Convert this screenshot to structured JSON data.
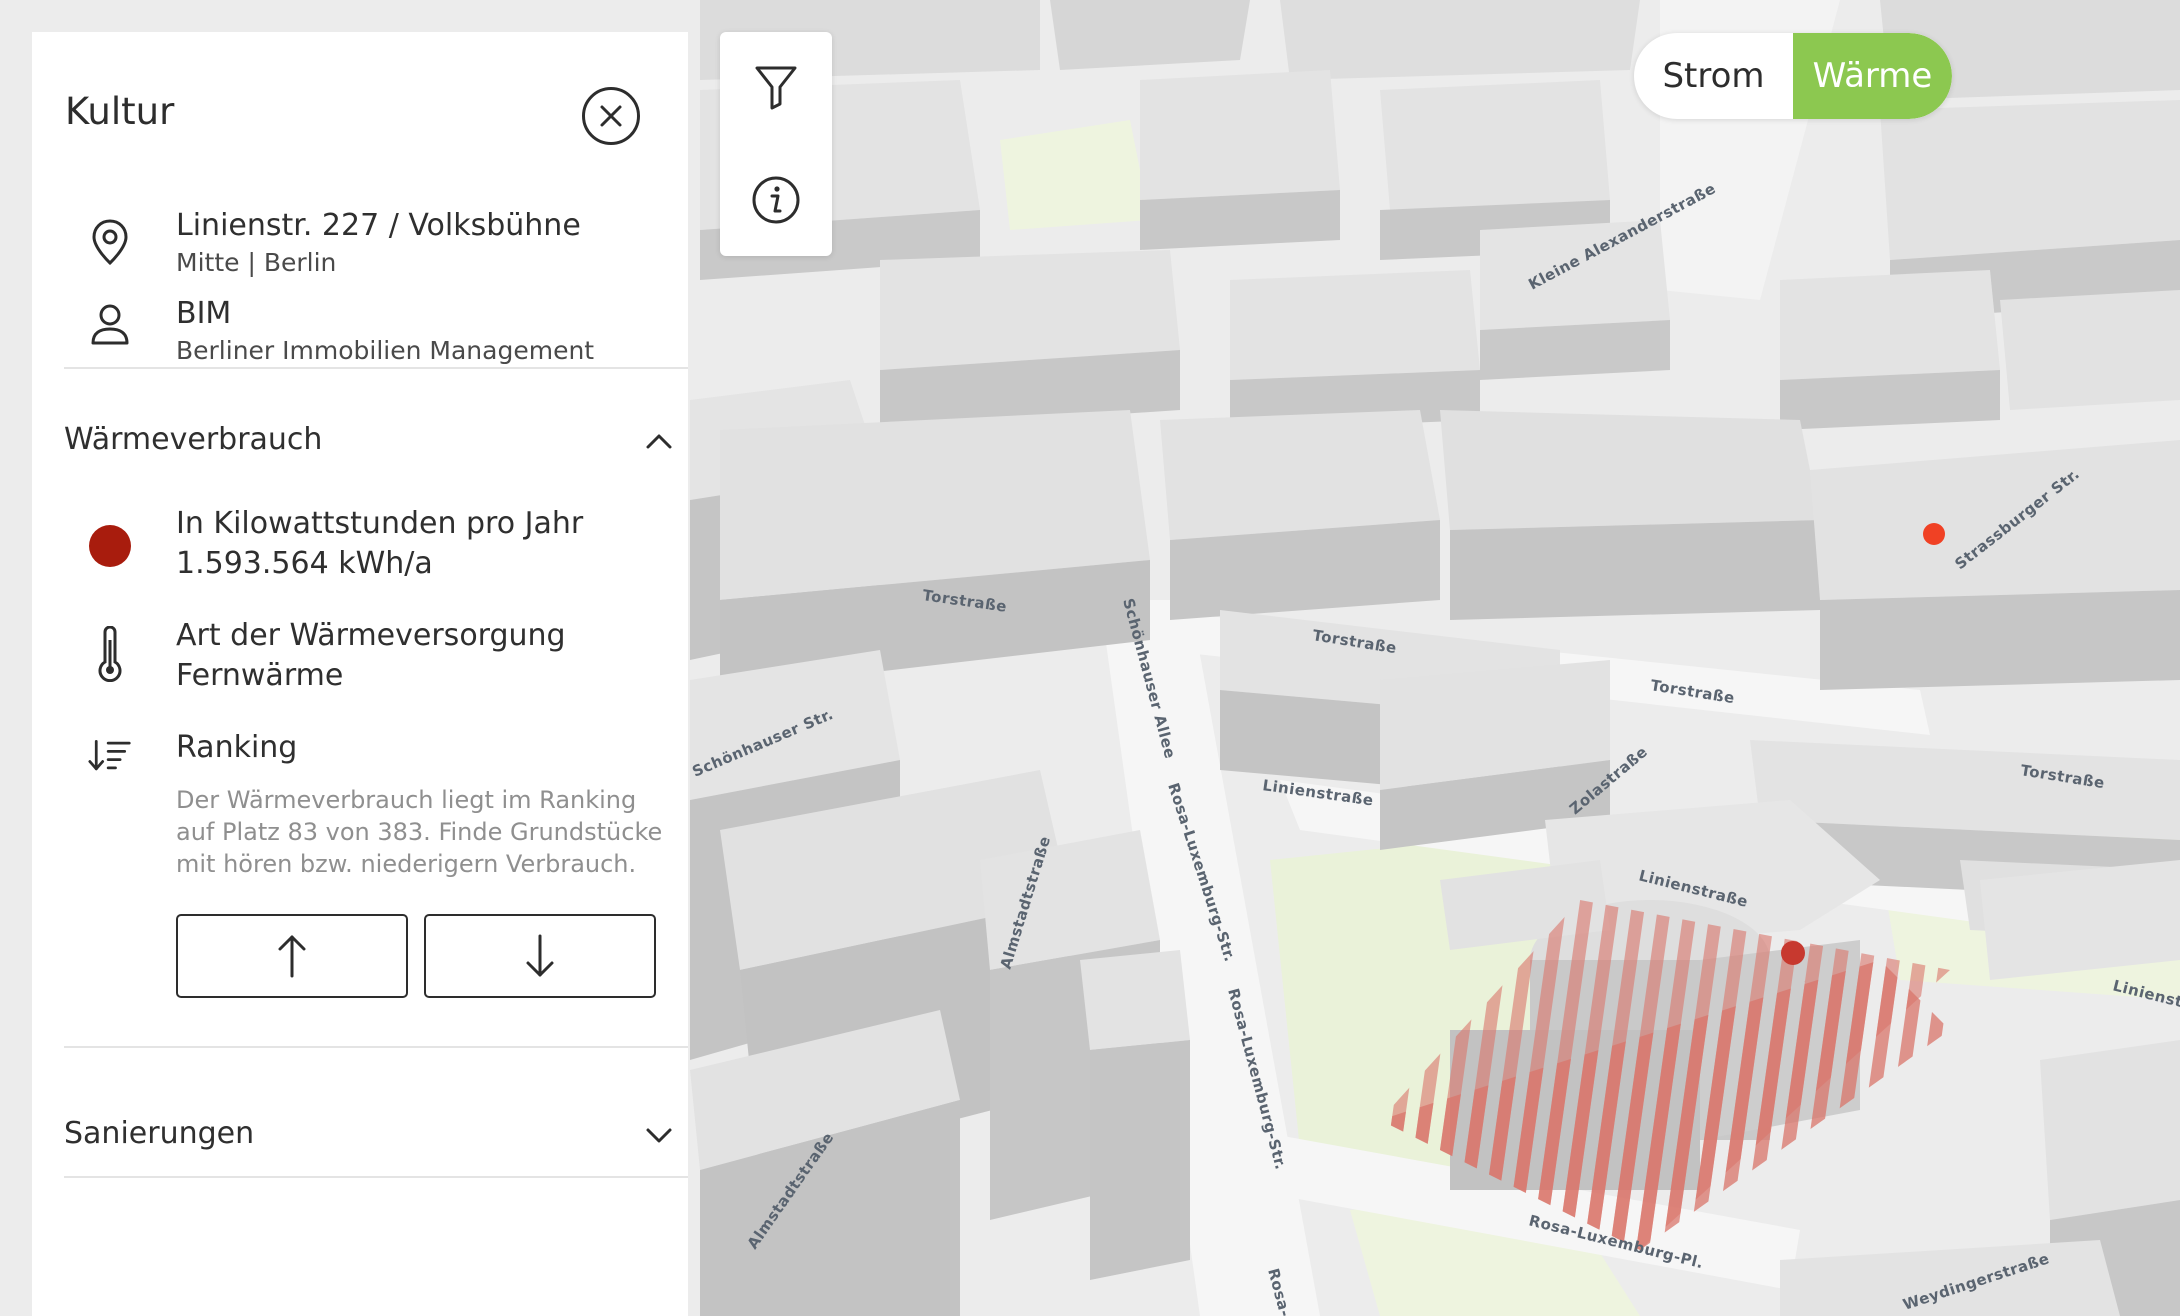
{
  "map": {
    "street_labels": [
      "Torstraße",
      "Torstraße",
      "Torstraße",
      "Torstraße",
      "Linienstraße",
      "Linienstraße",
      "Linienstraße",
      "Rosa-Luxemburg-Str.",
      "Rosa-Luxemburg-Str.",
      "Rosa-Luxemburg-Pl.",
      "Rosa-Lu",
      "Almstadtstraße",
      "Almstadtstraße",
      "Weydingerstraße",
      "Zolastraße",
      "Schönhauser Allee",
      "Schönhauser Str.",
      "Kleine Alexanderstraße",
      "Strassburger Str."
    ],
    "colors": {
      "ground": "#ececec",
      "building_top": "#e3e3e3",
      "building_side": "#c7c7c7",
      "park": "#eaf2d9",
      "marker": "#f04124",
      "selected_marker": "#c7392f",
      "selection_stripes": "#d9756b"
    }
  },
  "panel": {
    "title": "Kultur",
    "close_icon": "close-icon",
    "address": {
      "icon": "location-pin-icon",
      "line1": "Linienstr. 227 / Volksbühne",
      "line2": "Mitte | Berlin"
    },
    "owner": {
      "icon": "person-icon",
      "line1": "BIM",
      "line2": "Berliner Immobilien Management"
    },
    "heat_section": {
      "title": "Wärmeverbrauch",
      "expanded": true,
      "consumption": {
        "indicator_color": "#a81c0d",
        "label": "In Kilowattstunden pro Jahr",
        "value": "1.593.564 kWh/a"
      },
      "supply": {
        "icon": "thermometer-icon",
        "label": "Art der Wärmeversorgung",
        "value": "Fernwärme"
      },
      "ranking": {
        "icon": "sort-descending-icon",
        "label": "Ranking",
        "text": "Der Wärmeverbrauch liegt im Ranking auf Platz 83 von 383. Finde Grundstücke mit hören bzw. niederigern Verbrauch.",
        "up_icon": "arrow-up-icon",
        "down_icon": "arrow-down-icon"
      }
    },
    "renovation_section": {
      "title": "Sanierungen",
      "expanded": false
    }
  },
  "tools": {
    "filter_icon": "filter-icon",
    "info_icon": "info-icon"
  },
  "toggle": {
    "options": [
      "Strom",
      "Wärme"
    ],
    "selected": "Wärme",
    "active_color": "#8cc850"
  }
}
